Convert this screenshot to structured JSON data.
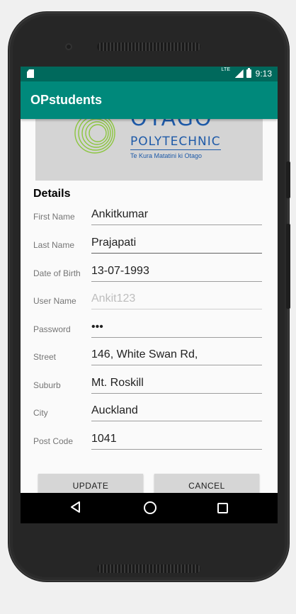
{
  "status_bar": {
    "network": "LTE",
    "time": "9:13"
  },
  "app_bar": {
    "title": "OPstudents"
  },
  "logo": {
    "name": "OTAGO",
    "subtitle": "POLYTECHNIC",
    "tagline": "Te Kura Matatini ki Otago"
  },
  "form": {
    "section_title": "Details",
    "fields": [
      {
        "label": "First Name",
        "value": "Ankitkumar",
        "placeholder": ""
      },
      {
        "label": "Last Name",
        "value": "Prajapati",
        "placeholder": ""
      },
      {
        "label": "Date of Birth",
        "value": "13-07-1993",
        "placeholder": ""
      },
      {
        "label": "User Name",
        "value": "",
        "placeholder": "Ankit123"
      },
      {
        "label": "Password",
        "value": "•••",
        "placeholder": ""
      },
      {
        "label": "Street",
        "value": "146, White Swan Rd,",
        "placeholder": ""
      },
      {
        "label": "Suburb",
        "value": "Mt. Roskill",
        "placeholder": ""
      },
      {
        "label": "City",
        "value": "Auckland",
        "placeholder": ""
      },
      {
        "label": "Post Code",
        "value": "1041",
        "placeholder": ""
      }
    ]
  },
  "buttons": {
    "update": "UPDATE",
    "cancel": "CANCEL"
  },
  "colors": {
    "status_bar": "#00695c",
    "app_bar": "#00897b",
    "logo_blue": "#1e5aa8",
    "logo_green": "#8cc63f"
  },
  "nav": {
    "back": "back-icon",
    "home": "home-icon",
    "recent": "recent-apps-icon"
  }
}
